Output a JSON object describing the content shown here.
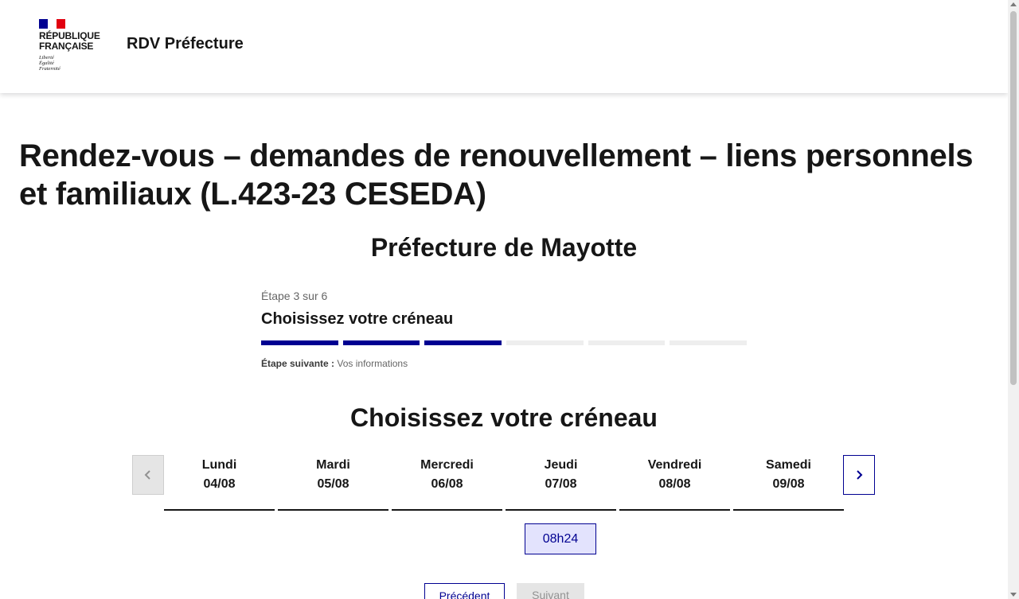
{
  "header": {
    "logo_lines": [
      "RÉPUBLIQUE",
      "FRANÇAISE"
    ],
    "motto_lines": [
      "Liberté",
      "Égalité",
      "Fraternité"
    ],
    "service_title": "RDV Préfecture"
  },
  "main": {
    "page_title": "Rendez-vous – demandes de renouvellement – liens personnels et familiaux (L.423-23 CESEDA)",
    "prefecture": "Préfecture de Mayotte"
  },
  "stepper": {
    "state": "Étape 3 sur 6",
    "current_step": 3,
    "total_steps": 6,
    "title": "Choisissez votre créneau",
    "next_label": "Étape suivante :",
    "next_value": "Vos informations"
  },
  "slots": {
    "title": "Choisissez votre créneau",
    "days": [
      {
        "name": "Lundi",
        "date": "04/08"
      },
      {
        "name": "Mardi",
        "date": "05/08"
      },
      {
        "name": "Mercredi",
        "date": "06/08"
      },
      {
        "name": "Jeudi",
        "date": "07/08"
      },
      {
        "name": "Vendredi",
        "date": "08/08"
      },
      {
        "name": "Samedi",
        "date": "09/08"
      }
    ],
    "slot_time": "08h24",
    "prev_icon": "chevron-left-icon",
    "next_icon": "chevron-right-icon"
  },
  "actions": {
    "previous_label": "Précédent",
    "next_label": "Suivant"
  },
  "colors": {
    "accent": "#000091",
    "flag_red": "#e1000f",
    "disabled": "#e5e5e5",
    "slot_bg": "#e3e3fd"
  }
}
